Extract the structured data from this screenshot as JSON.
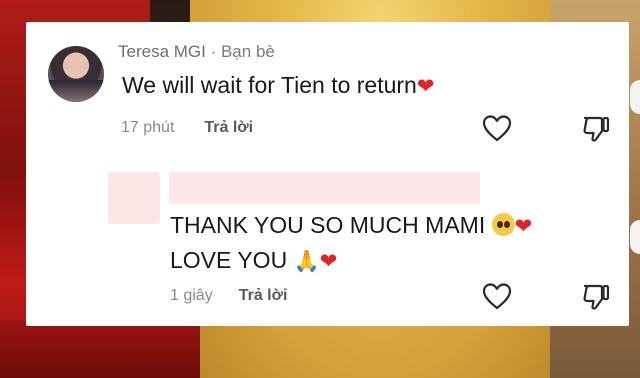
{
  "comment1": {
    "author_name": "Teresa MGI",
    "author_tag": "Bạn bè",
    "text": "We will wait for Tien to return",
    "time": "17 phút",
    "reply_label": "Trả lời"
  },
  "comment2": {
    "line1": "THANK YOU SO MUCH MAMI",
    "line2": "LOVE YOU",
    "time": "1 giây",
    "reply_label": "Trả lời"
  },
  "separator": " · ",
  "icons": {
    "heart": "red-heart-emoji",
    "pleading": "pleading-face-emoji",
    "pray": "folded-hands-emoji",
    "like": "heart-outline-icon",
    "dislike": "thumbs-down-icon"
  },
  "colors": {
    "heart_red": "#e02424",
    "text_primary": "#161823",
    "text_secondary": "#8a8a8a",
    "redacted_pink": "#fde7ea"
  }
}
